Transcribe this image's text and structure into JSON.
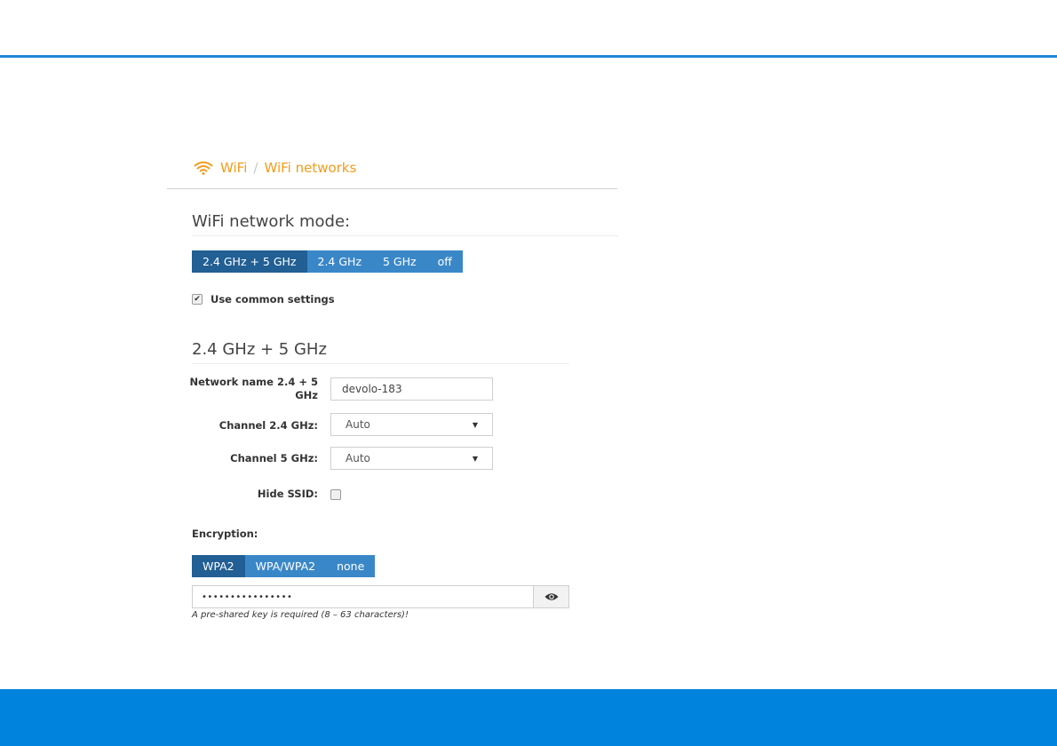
{
  "colors": {
    "accent": "#1e88d6",
    "brand_band": "#0083dd",
    "breadcrumb": "#f39b1c",
    "button": "#3a87c8",
    "button_active": "#215f94"
  },
  "breadcrumb": {
    "icon": "wifi-icon",
    "root": "WiFi",
    "separator": "/",
    "current": "WiFi networks"
  },
  "mode": {
    "title": "WiFi network mode:",
    "options": [
      "2.4 GHz + 5 GHz",
      "2.4 GHz",
      "5 GHz",
      "off"
    ],
    "selected": "2.4 GHz + 5 GHz"
  },
  "common_settings": {
    "label": "Use common settings",
    "checked": true
  },
  "band_section": {
    "title": "2.4 GHz + 5 GHz",
    "network_name_label": "Network name 2.4 + 5 GHz",
    "network_name_value": "devolo-183",
    "channel24_label": "Channel 2.4 GHz:",
    "channel24_value": "Auto",
    "channel5_label": "Channel 5 GHz:",
    "channel5_value": "Auto",
    "hide_ssid_label": "Hide SSID:",
    "hide_ssid_checked": false
  },
  "encryption": {
    "label": "Encryption:",
    "options": [
      "WPA2",
      "WPA/WPA2",
      "none"
    ],
    "selected": "WPA2",
    "password_masked": "••••••••••••••••",
    "show_password_icon": "eye-icon",
    "hint": "A pre-shared key is required (8 – 63 characters)!"
  }
}
